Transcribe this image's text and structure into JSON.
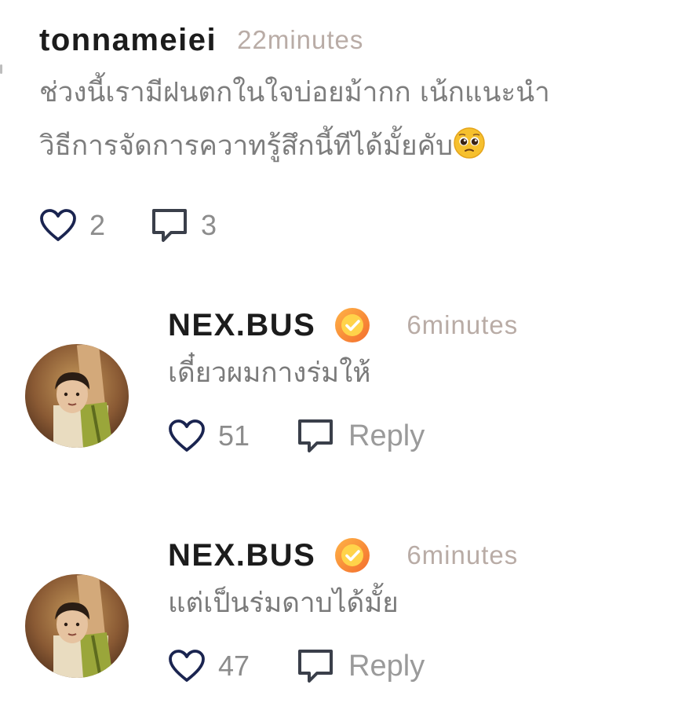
{
  "comments": [
    {
      "username": "tonnameiei",
      "time": "22minutes",
      "text_line1": "ช่วงนี้เรามีฝนตกในใจบ่อยม้ากก เน้กแนะนำ",
      "text_line2": "วิธีการจัดการควาทรู้สึกนี้ทีได้มั้ยคับ",
      "emoji": "pleading-face",
      "likes": "2",
      "replies": "3"
    }
  ],
  "replies": [
    {
      "username": "NEX.BUS",
      "verified": true,
      "time": "6minutes",
      "text": "เดี๋ยวผมกางร่มให้",
      "likes": "51",
      "reply_label": "Reply"
    },
    {
      "username": "NEX.BUS",
      "verified": true,
      "time": "6minutes",
      "text": "แต่เป็นร่มดาบได้มั้ย",
      "likes": "47",
      "reply_label": "Reply"
    }
  ],
  "colors": {
    "heart_outline": "#1a2450",
    "comment_icon": "#3a3f4a",
    "verified_badge": "#f7a534",
    "timestamp": "#b9aca6"
  },
  "icons": {
    "like": "heart-outline-icon",
    "comment": "speech-bubble-icon",
    "verified": "verified-check-icon"
  }
}
